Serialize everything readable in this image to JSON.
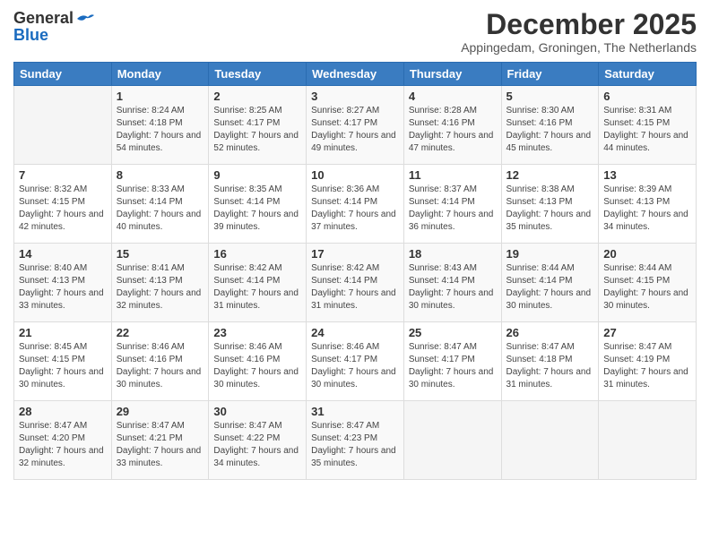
{
  "logo": {
    "general": "General",
    "blue": "Blue"
  },
  "title": {
    "month_year": "December 2025",
    "location": "Appingedam, Groningen, The Netherlands"
  },
  "headers": [
    "Sunday",
    "Monday",
    "Tuesday",
    "Wednesday",
    "Thursday",
    "Friday",
    "Saturday"
  ],
  "weeks": [
    [
      {
        "day": "",
        "empty": true
      },
      {
        "day": "1",
        "sunrise": "8:24 AM",
        "sunset": "4:18 PM",
        "daylight": "7 hours and 54 minutes."
      },
      {
        "day": "2",
        "sunrise": "8:25 AM",
        "sunset": "4:17 PM",
        "daylight": "7 hours and 52 minutes."
      },
      {
        "day": "3",
        "sunrise": "8:27 AM",
        "sunset": "4:17 PM",
        "daylight": "7 hours and 49 minutes."
      },
      {
        "day": "4",
        "sunrise": "8:28 AM",
        "sunset": "4:16 PM",
        "daylight": "7 hours and 47 minutes."
      },
      {
        "day": "5",
        "sunrise": "8:30 AM",
        "sunset": "4:16 PM",
        "daylight": "7 hours and 45 minutes."
      },
      {
        "day": "6",
        "sunrise": "8:31 AM",
        "sunset": "4:15 PM",
        "daylight": "7 hours and 44 minutes."
      }
    ],
    [
      {
        "day": "7",
        "sunrise": "8:32 AM",
        "sunset": "4:15 PM",
        "daylight": "7 hours and 42 minutes."
      },
      {
        "day": "8",
        "sunrise": "8:33 AM",
        "sunset": "4:14 PM",
        "daylight": "7 hours and 40 minutes."
      },
      {
        "day": "9",
        "sunrise": "8:35 AM",
        "sunset": "4:14 PM",
        "daylight": "7 hours and 39 minutes."
      },
      {
        "day": "10",
        "sunrise": "8:36 AM",
        "sunset": "4:14 PM",
        "daylight": "7 hours and 37 minutes."
      },
      {
        "day": "11",
        "sunrise": "8:37 AM",
        "sunset": "4:14 PM",
        "daylight": "7 hours and 36 minutes."
      },
      {
        "day": "12",
        "sunrise": "8:38 AM",
        "sunset": "4:13 PM",
        "daylight": "7 hours and 35 minutes."
      },
      {
        "day": "13",
        "sunrise": "8:39 AM",
        "sunset": "4:13 PM",
        "daylight": "7 hours and 34 minutes."
      }
    ],
    [
      {
        "day": "14",
        "sunrise": "8:40 AM",
        "sunset": "4:13 PM",
        "daylight": "7 hours and 33 minutes."
      },
      {
        "day": "15",
        "sunrise": "8:41 AM",
        "sunset": "4:13 PM",
        "daylight": "7 hours and 32 minutes."
      },
      {
        "day": "16",
        "sunrise": "8:42 AM",
        "sunset": "4:14 PM",
        "daylight": "7 hours and 31 minutes."
      },
      {
        "day": "17",
        "sunrise": "8:42 AM",
        "sunset": "4:14 PM",
        "daylight": "7 hours and 31 minutes."
      },
      {
        "day": "18",
        "sunrise": "8:43 AM",
        "sunset": "4:14 PM",
        "daylight": "7 hours and 30 minutes."
      },
      {
        "day": "19",
        "sunrise": "8:44 AM",
        "sunset": "4:14 PM",
        "daylight": "7 hours and 30 minutes."
      },
      {
        "day": "20",
        "sunrise": "8:44 AM",
        "sunset": "4:15 PM",
        "daylight": "7 hours and 30 minutes."
      }
    ],
    [
      {
        "day": "21",
        "sunrise": "8:45 AM",
        "sunset": "4:15 PM",
        "daylight": "7 hours and 30 minutes."
      },
      {
        "day": "22",
        "sunrise": "8:46 AM",
        "sunset": "4:16 PM",
        "daylight": "7 hours and 30 minutes."
      },
      {
        "day": "23",
        "sunrise": "8:46 AM",
        "sunset": "4:16 PM",
        "daylight": "7 hours and 30 minutes."
      },
      {
        "day": "24",
        "sunrise": "8:46 AM",
        "sunset": "4:17 PM",
        "daylight": "7 hours and 30 minutes."
      },
      {
        "day": "25",
        "sunrise": "8:47 AM",
        "sunset": "4:17 PM",
        "daylight": "7 hours and 30 minutes."
      },
      {
        "day": "26",
        "sunrise": "8:47 AM",
        "sunset": "4:18 PM",
        "daylight": "7 hours and 31 minutes."
      },
      {
        "day": "27",
        "sunrise": "8:47 AM",
        "sunset": "4:19 PM",
        "daylight": "7 hours and 31 minutes."
      }
    ],
    [
      {
        "day": "28",
        "sunrise": "8:47 AM",
        "sunset": "4:20 PM",
        "daylight": "7 hours and 32 minutes."
      },
      {
        "day": "29",
        "sunrise": "8:47 AM",
        "sunset": "4:21 PM",
        "daylight": "7 hours and 33 minutes."
      },
      {
        "day": "30",
        "sunrise": "8:47 AM",
        "sunset": "4:22 PM",
        "daylight": "7 hours and 34 minutes."
      },
      {
        "day": "31",
        "sunrise": "8:47 AM",
        "sunset": "4:23 PM",
        "daylight": "7 hours and 35 minutes."
      },
      {
        "day": "",
        "empty": true
      },
      {
        "day": "",
        "empty": true
      },
      {
        "day": "",
        "empty": true
      }
    ]
  ],
  "labels": {
    "sunrise_prefix": "Sunrise: ",
    "sunset_prefix": "Sunset: ",
    "daylight_prefix": "Daylight: "
  }
}
